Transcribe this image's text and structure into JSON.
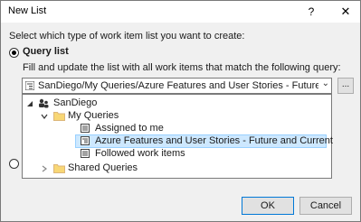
{
  "window": {
    "title": "New List",
    "help_glyph": "?",
    "close_glyph": "✕"
  },
  "dialog": {
    "prompt": "Select which type of work item list you want to create:",
    "query_option_label": "Query list",
    "query_option_selected": true,
    "fill_text": "Fill and update the list with all work items that match the following query:",
    "selected_query_path": "SanDiego/My Queries/Azure Features and User Stories - Future and Curre",
    "browse_button_label": "...",
    "ok_label": "OK",
    "cancel_label": "Cancel"
  },
  "tree": {
    "root": {
      "label": "SanDiego",
      "icon": "team-project-icon"
    },
    "my_queries": {
      "label": "My Queries",
      "icon": "folder-icon"
    },
    "items": [
      {
        "label": "Assigned to me",
        "icon": "flat-list-query-icon"
      },
      {
        "label": "Azure Features and User Stories - Future and Current",
        "icon": "tree-query-icon",
        "selected": true
      },
      {
        "label": "Followed work items",
        "icon": "flat-list-query-icon"
      }
    ],
    "shared_queries": {
      "label": "Shared Queries",
      "icon": "folder-icon"
    }
  },
  "colors": {
    "selection": "#cde8ff",
    "folder": "#dcb67a",
    "default_button_border": "#0078d7"
  }
}
